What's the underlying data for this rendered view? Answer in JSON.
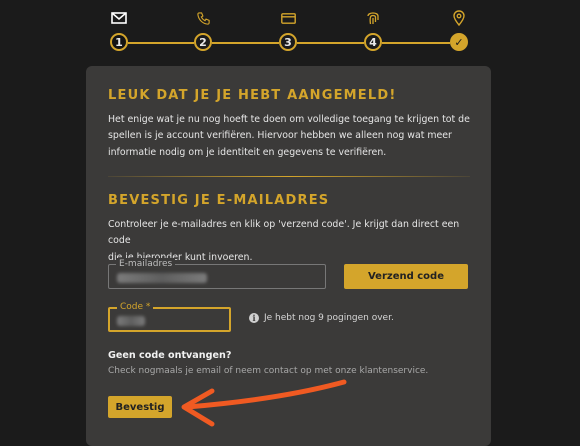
{
  "stepper": {
    "steps": [
      {
        "icon": "envelope-icon",
        "label": "1",
        "state": "active"
      },
      {
        "icon": "phone-icon",
        "label": "2",
        "state": "todo"
      },
      {
        "icon": "card-icon",
        "label": "3",
        "state": "todo"
      },
      {
        "icon": "fingerprint-icon",
        "label": "4",
        "state": "todo"
      },
      {
        "icon": "location-pin-icon",
        "label": "✓",
        "state": "done"
      }
    ],
    "accent": "#d4a52b"
  },
  "welcome": {
    "title": "Leuk dat je je hebt aangemeld!",
    "line1": "Het enige wat je nu nog hoeft te doen om volledige toegang te krijgen tot de",
    "line2": "spellen is je account verifiëren. Hiervoor hebben we alleen nog wat meer",
    "line3": "informatie nodig om je identiteit en gegevens te verifiëren."
  },
  "verify": {
    "title": "Bevestig je e-mailadres",
    "line1": "Controleer je e-mailadres en klik op 'verzend code'. Je krijgt dan direct een code",
    "line2": "die je hieronder kunt invoeren.",
    "email_label": "E-mailadres",
    "send_button": "Verzend code",
    "code_label": "Code *",
    "attempts_text": "Je hebt nog 9 pogingen over.",
    "info_icon": "i",
    "no_code_title": "Geen code ontvangen?",
    "no_code_text": "Check nogmaals je email of neem contact op met onze klantenservice.",
    "confirm_button": "Bevestig"
  },
  "annotation": {
    "arrow_color": "#f05a22"
  }
}
